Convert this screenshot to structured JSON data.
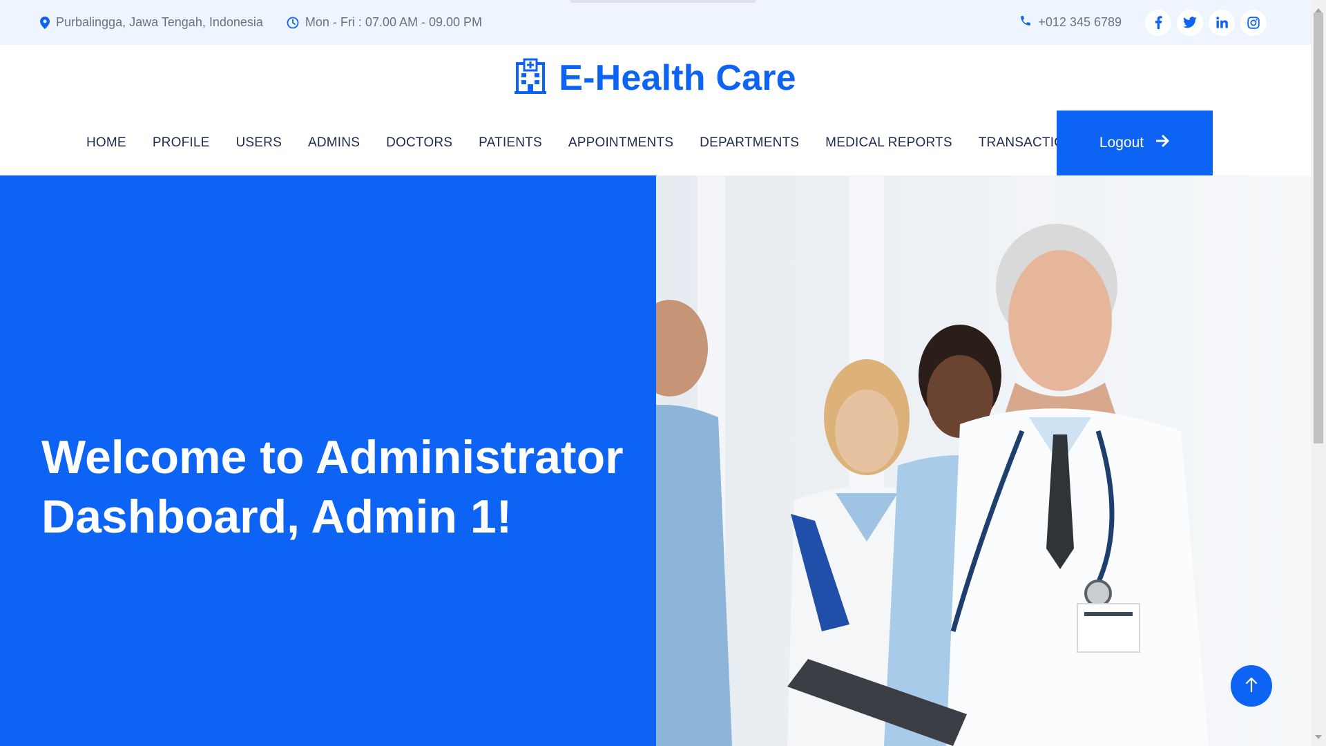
{
  "topbar": {
    "address": "Purbalingga, Jawa Tengah, Indonesia",
    "hours": "Mon - Fri : 07.00 AM - 09.00 PM",
    "phone": "+012 345 6789",
    "socials": [
      "facebook-icon",
      "twitter-icon",
      "linkedin-icon",
      "instagram-icon"
    ]
  },
  "brand": {
    "title": "E-Health Care",
    "icon": "hospital-icon"
  },
  "nav": {
    "items": [
      {
        "label": "HOME"
      },
      {
        "label": "PROFILE"
      },
      {
        "label": "USERS"
      },
      {
        "label": "ADMINS"
      },
      {
        "label": "DOCTORS"
      },
      {
        "label": "PATIENTS"
      },
      {
        "label": "APPOINTMENTS"
      },
      {
        "label": "DEPARTMENTS"
      },
      {
        "label": "MEDICAL REPORTS"
      },
      {
        "label": "TRANSACTIONS"
      }
    ],
    "logout_label": "Logout"
  },
  "hero": {
    "title_line1": "Welcome to Administrator",
    "title_line2": "Dashboard, Admin 1!"
  },
  "colors": {
    "primary": "#0d63f3",
    "topbar_bg": "#eff5ff",
    "text_dark": "#1d2a4d",
    "text_muted": "#6b7280"
  }
}
